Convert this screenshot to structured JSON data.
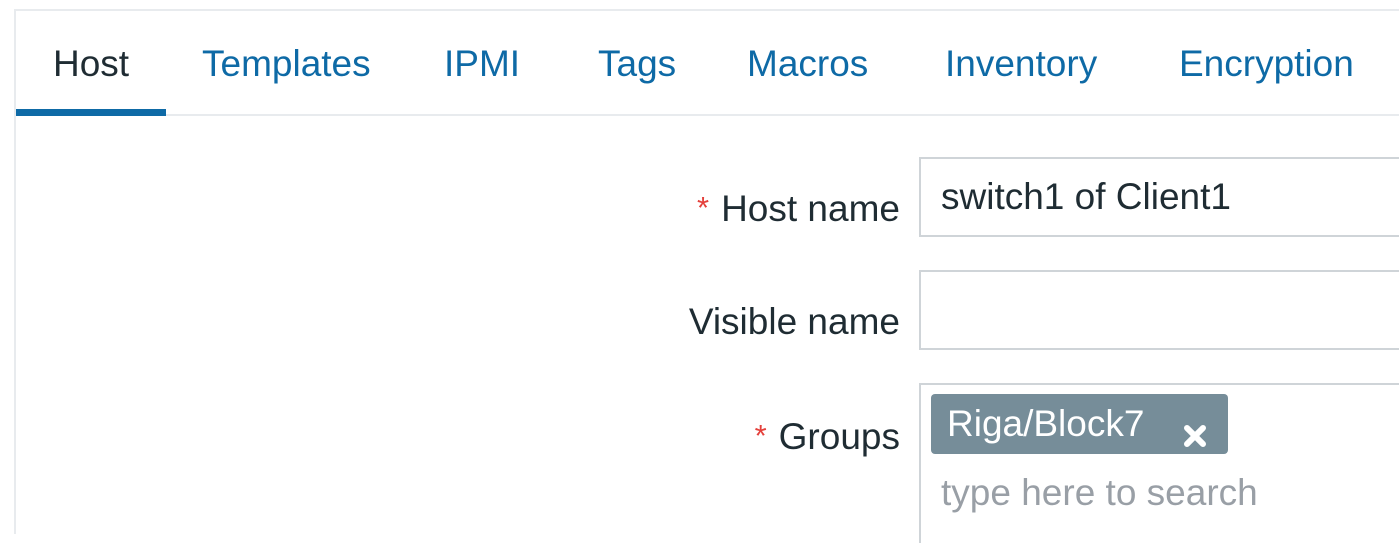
{
  "tabs": [
    {
      "label": "Host",
      "active": true
    },
    {
      "label": "Templates"
    },
    {
      "label": "IPMI"
    },
    {
      "label": "Tags"
    },
    {
      "label": "Macros"
    },
    {
      "label": "Inventory"
    },
    {
      "label": "Encryption"
    }
  ],
  "form": {
    "required_marker": "*",
    "host_name": {
      "label": "Host name",
      "value": "switch1 of Client1",
      "required": true
    },
    "visible_name": {
      "label": "Visible name",
      "value": ""
    },
    "groups": {
      "label": "Groups",
      "required": true,
      "selected": [
        {
          "label": "Riga/Block7",
          "remove_icon": "close-icon"
        }
      ],
      "placeholder": "type here to search"
    }
  },
  "colors": {
    "link": "#0e6aa6",
    "text": "#1f2c33",
    "required": "#e4403b",
    "chip_bg": "#768d99",
    "placeholder": "#999fa6"
  }
}
